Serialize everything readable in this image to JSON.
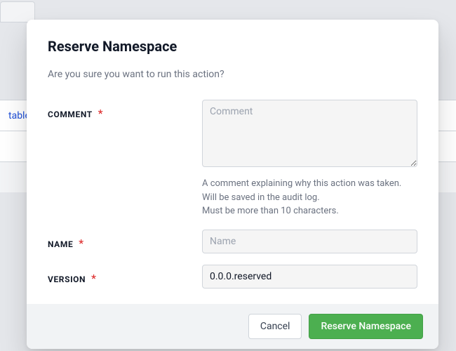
{
  "background": {
    "link_text": "table"
  },
  "modal": {
    "title": "Reserve Namespace",
    "subtitle": "Are you sure you want to run this action?",
    "fields": {
      "comment": {
        "label": "COMMENT",
        "required_mark": "*",
        "placeholder": "Comment",
        "value": "",
        "help_line1": "A comment explaining why this action was taken.",
        "help_line2": "Will be saved in the audit log.",
        "help_line3": "Must be more than 10 characters."
      },
      "name": {
        "label": "NAME",
        "required_mark": "*",
        "placeholder": "Name",
        "value": ""
      },
      "version": {
        "label": "VERSION",
        "required_mark": "*",
        "placeholder": "",
        "value": "0.0.0.reserved"
      }
    },
    "buttons": {
      "cancel": "Cancel",
      "submit": "Reserve Namespace"
    }
  }
}
